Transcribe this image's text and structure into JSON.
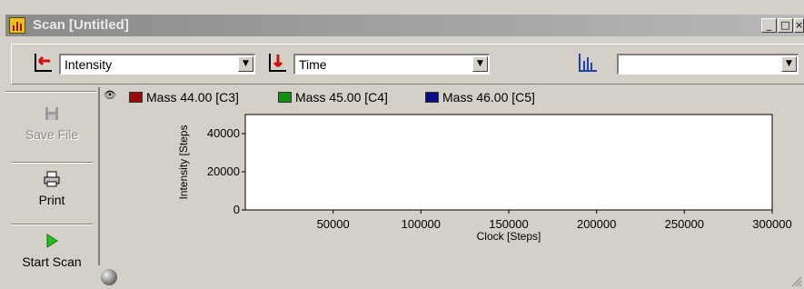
{
  "window": {
    "title": "Scan [Untitled]",
    "controls": {
      "minimize": "_",
      "maximize": "□",
      "close": "×"
    }
  },
  "toolbar": {
    "y_axis_icon": "y-axis-select-icon",
    "y_axis_value": "Intensity",
    "x_axis_icon": "x-axis-select-icon",
    "x_axis_value": "Time",
    "chart_type_icon": "bar-chart-icon",
    "chart_type_value": ""
  },
  "sidebar": {
    "items": [
      {
        "label": "Save File",
        "icon": "floppy-disk-icon",
        "enabled": false
      },
      {
        "label": "Print",
        "icon": "printer-icon",
        "enabled": true
      },
      {
        "label": "Start Scan",
        "icon": "play-icon",
        "enabled": true
      }
    ]
  },
  "legend": {
    "items": [
      {
        "label": "Mass  44.00 [C3]",
        "color": "#9b0a0a"
      },
      {
        "label": "Mass  45.00 [C4]",
        "color": "#109010"
      },
      {
        "label": "Mass  46.00 [C5]",
        "color": "#0a0a8c"
      }
    ]
  },
  "chart_data": {
    "type": "line",
    "xlabel": "Clock [Steps]",
    "ylabel": "Intensity [Steps",
    "x_ticks": [
      50000,
      100000,
      150000,
      200000,
      250000,
      300000
    ],
    "y_ticks": [
      0,
      20000,
      40000
    ],
    "xlim": [
      0,
      300000
    ],
    "ylim": [
      0,
      50000
    ],
    "grid": false,
    "series": [
      {
        "name": "Mass  44.00 [C3]",
        "values": []
      },
      {
        "name": "Mass  45.00 [C4]",
        "values": []
      },
      {
        "name": "Mass  46.00 [C5]",
        "values": []
      }
    ]
  }
}
